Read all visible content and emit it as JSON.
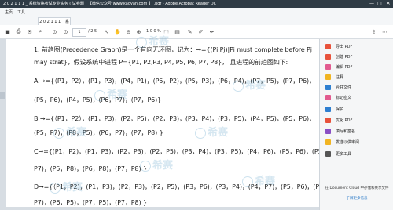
{
  "window": {
    "title": "2 0 2 1 1 1 _ 系统资格考试专业实务 ( 试卷题 ) 【微信公众号 www.kaoyan.com 】 .pdf - Adobe Acrobat Reader DC",
    "min": "—",
    "max": "□",
    "close": "✕"
  },
  "menu": {
    "home": "主页",
    "tools": "工具"
  },
  "tab": {
    "label": "2 0 2 1 1 1 _ 系统 ... ×"
  },
  "toolbar": {
    "page_current": "1",
    "page_total": "/ 2 5",
    "zoom": "1 0 0 %"
  },
  "document": {
    "lines": [
      "1. 前趋图(Precedence Graph)是一个有向无环图，记为：→={(Pi,Pj)|Pi must complete before Pj",
      "may strat}，假设系统中进程 P={P1, P2,P3, P4, P5, P6, P7, P8}， 且进程的前趋图如下:",
      "A →={（P1，P2），(P1，P3)，(P4，P1)，(P5，P2)，(P5，P3)，(P6，P4)，(P7，P5)，(P7，P6)，",
      "(P5，P6)，(P4，P5)，(P6，P7)，(P7，P6)}",
      "B →={（P1，P2），(P1，P3)，(P2，P5)，(P2，P3)，(P3，P4)，(P3，P5)，(P4，P5)，(P5，P6)，",
      "(P5，P7)，(P8，P5)，(P6，P7)，(P7，P8) }",
      "C→={(P1，P2)，(P1，P3)，(P2，P3)，(P2，P5)，(P3，P4)，(P3，P5)，(P4，P6)，(P5，P6)，(P5，",
      "P7)，(P5，P8)，(P6，P8)，(P7，P8) }",
      "D→={（P1，P2)，(P1，P3)，(P2，P3)，(P2，P5)，(P3，P6)，(P3，P4)，(P4，P7)，(P5，P6)，(P6，",
      "P7)，(P6，P5)，(P7，P5)，(P7，P8) }"
    ],
    "watermark": "希赛"
  },
  "right_panel": {
    "tools": [
      {
        "label": "导出 PDF",
        "color": "#e8523b"
      },
      {
        "label": "创建 PDF",
        "color": "#e8523b"
      },
      {
        "label": "编辑 PDF",
        "color": "#e25b8f"
      },
      {
        "label": "注释",
        "color": "#f1b422"
      },
      {
        "label": "合并文件",
        "color": "#2f7fd0"
      },
      {
        "label": "标记密文",
        "color": "#e25b8f"
      },
      {
        "label": "保护",
        "color": "#2f7fd0"
      },
      {
        "label": "优化 PDF",
        "color": "#e8523b"
      },
      {
        "label": "填写和签名",
        "color": "#8a4fc4"
      },
      {
        "label": "发送以供审阅",
        "color": "#f1b422"
      },
      {
        "label": "更多工具",
        "color": "#555555"
      }
    ],
    "promo_text": "在 Document Cloud 中存储和共享文件",
    "promo_link": "了解更多信息"
  }
}
